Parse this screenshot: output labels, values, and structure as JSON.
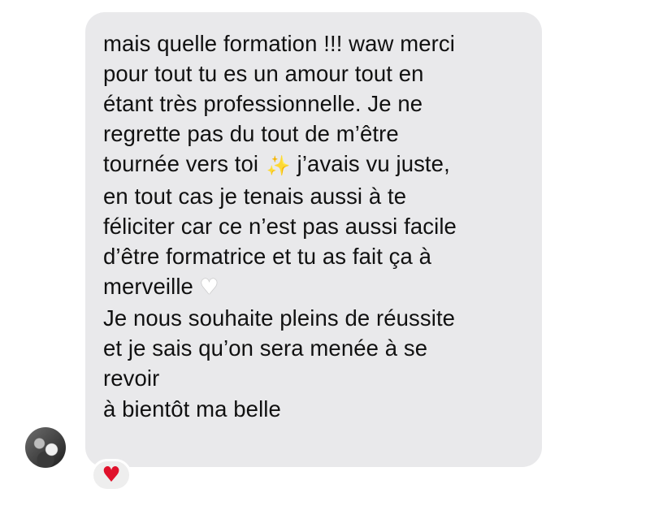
{
  "message": {
    "lines": [
      "mais quelle formation !!! waw merci",
      "pour tout tu es un amour tout en",
      "étant très professionnelle. Je ne",
      "regrette pas du tout de m’être",
      "tournée vers toi",
      " j’avais vu juste,",
      "en tout cas je tenais aussi à te",
      "féliciter car ce n’est pas aussi facile",
      "d’être formatrice et tu as fait ça à",
      "merveille",
      "Je nous souhaite pleins de réussite",
      "et je sais qu’on sera menée à se",
      "revoir",
      "à bientôt ma belle"
    ],
    "sparkles_emoji": "✨",
    "white_heart_emoji": "♥"
  },
  "reaction": {
    "emoji": "♥",
    "color": "#e0112b"
  },
  "colors": {
    "bubble": "#e9e9eb",
    "text": "#111111",
    "background": "#ffffff"
  },
  "icons": [
    "avatar",
    "sparkles-emoji",
    "white-heart-emoji",
    "heart-reaction-icon"
  ]
}
